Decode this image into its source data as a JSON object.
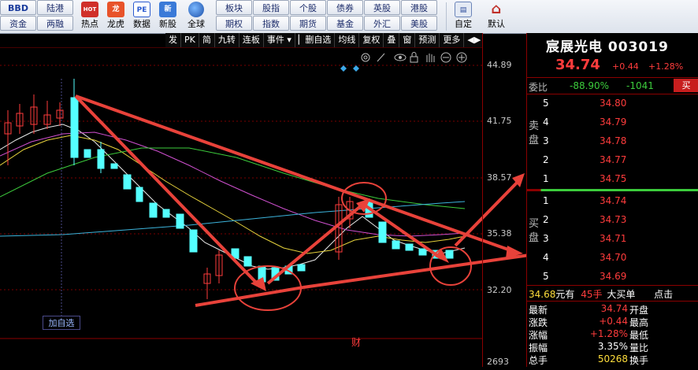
{
  "toolbar": {
    "grid_row1": [
      "BBD",
      "陆港",
      "板块",
      "股指",
      "个股",
      "债券",
      "英股",
      "港股"
    ],
    "grid_row2": [
      "资金",
      "两融",
      "期权",
      "指数",
      "期货",
      "基金",
      "外汇",
      "美股"
    ],
    "icons": [
      {
        "label": "热点",
        "icon": "hot-icon",
        "color": "#d0302a",
        "text": "HOT"
      },
      {
        "label": "龙虎",
        "icon": "dragon-tiger-icon",
        "color": "#e8532a",
        "text": "龙"
      },
      {
        "label": "数据",
        "icon": "data-pe-icon",
        "color": "#2a5ad0",
        "text": "PE"
      },
      {
        "label": "新股",
        "icon": "new-stock-icon",
        "color": "#3a7ad8",
        "text": "新"
      },
      {
        "label": "全球",
        "icon": "globe-icon",
        "color": "#2a6ac8",
        "text": "◉"
      }
    ],
    "right_icons": [
      {
        "label": "自定",
        "icon": "customize-icon"
      },
      {
        "label": "默认",
        "icon": "home-icon"
      }
    ]
  },
  "chart_toolbar": [
    "发",
    "PK",
    "简",
    "九转",
    "连板",
    "事件 ▾",
    "▏删自选",
    "均线",
    "复权",
    "叠",
    "窗",
    "预测",
    "更多",
    "◀▶"
  ],
  "chart_icons": [
    "settings-icon",
    "draw-icon",
    "eye-icon",
    "lock-icon",
    "hand-icon",
    "zoom-out-icon",
    "zoom-in-icon"
  ],
  "price_axis": [
    "44.89",
    "41.75",
    "38.57",
    "35.38",
    "32.20"
  ],
  "volume_axis_label": "2693",
  "add_watchlist_label": "加自选",
  "cai_marker": "财",
  "stock": {
    "name": "宸展光电 003019",
    "price": "34.74",
    "change": "+0.44",
    "pct": "+1.28%",
    "weibi_label": "委比",
    "weibi": "-88.90%",
    "weicha": "-1041",
    "sell_btn": "买"
  },
  "order_book": {
    "sell_label": "卖盘",
    "buy_label": "买盘",
    "sells": [
      {
        "idx": "5",
        "price": "34.80"
      },
      {
        "idx": "4",
        "price": "34.79"
      },
      {
        "idx": "3",
        "price": "34.78"
      },
      {
        "idx": "2",
        "price": "34.77"
      },
      {
        "idx": "1",
        "price": "34.75"
      }
    ],
    "buys": [
      {
        "idx": "1",
        "price": "34.74"
      },
      {
        "idx": "2",
        "price": "34.73"
      },
      {
        "idx": "3",
        "price": "34.71"
      },
      {
        "idx": "4",
        "price": "34.70"
      },
      {
        "idx": "5",
        "price": "34.69"
      }
    ]
  },
  "trade_line": {
    "price": "34.68",
    "unit": "元有",
    "qty": "45手",
    "side": "大买单",
    "extra": "点击"
  },
  "stats": [
    {
      "k1": "最新",
      "v1": "34.74",
      "k2": "开盘"
    },
    {
      "k1": "涨跌",
      "v1": "+0.44",
      "k2": "最高"
    },
    {
      "k1": "涨幅",
      "v1": "+1.28%",
      "k2": "最低"
    },
    {
      "k1": "振幅",
      "v1": "3.35%",
      "k2": "量比"
    },
    {
      "k1": "总手",
      "v1": "50268",
      "k2": "换手"
    }
  ]
}
